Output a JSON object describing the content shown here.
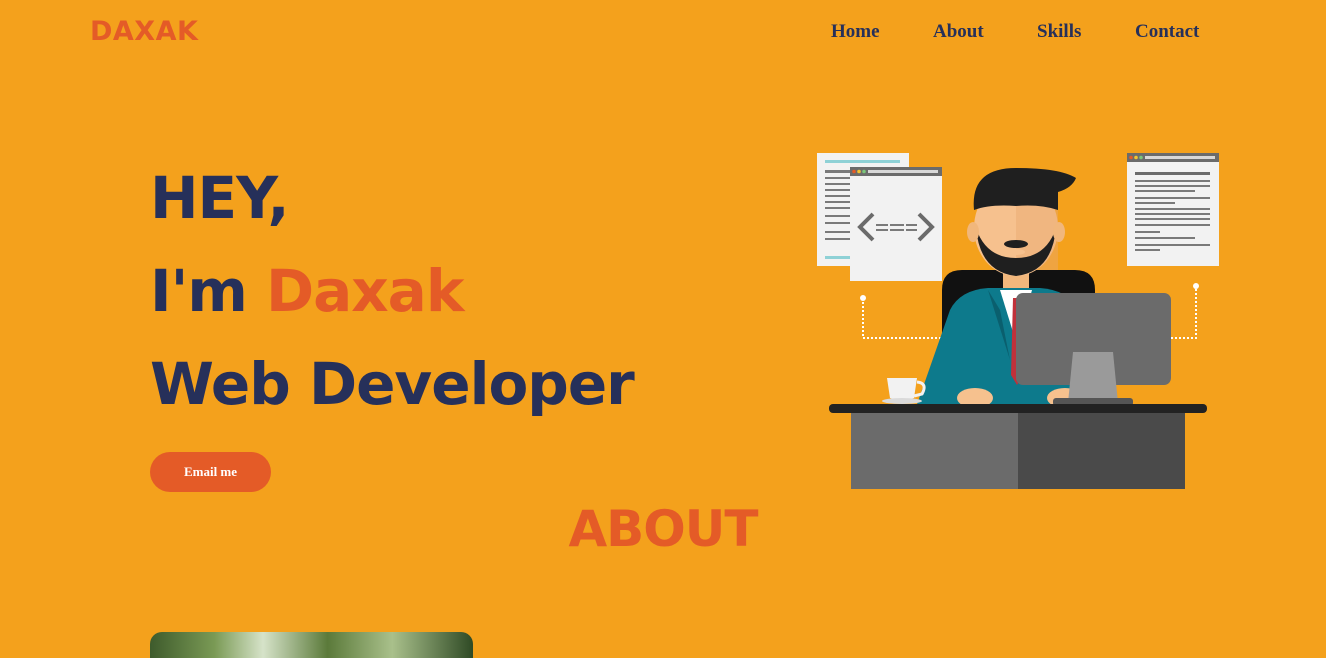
{
  "header": {
    "logo": "DAXAK",
    "nav": [
      {
        "label": "Home"
      },
      {
        "label": "About"
      },
      {
        "label": "Skills"
      },
      {
        "label": "Contact"
      }
    ]
  },
  "hero": {
    "line1": "HEY,",
    "line2_prefix": "I'm",
    "line2_name": "Daxak",
    "line3": "Web Developer",
    "email_button": "Email me"
  },
  "about": {
    "title": "ABOUT"
  },
  "colors": {
    "background": "#F4A11C",
    "accent": "#E45B27",
    "navy": "#26305A"
  },
  "icons": [
    "developer-illustration",
    "code-window-icon",
    "document-icon",
    "coffee-cup-icon",
    "monitor-icon"
  ]
}
